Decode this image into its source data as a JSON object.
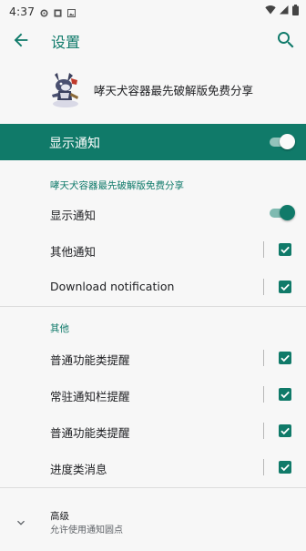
{
  "status_bar": {
    "time": "4:37"
  },
  "app_bar": {
    "title": "设置"
  },
  "app_header": {
    "app_name": "哮天犬容器最先破解版免费分享"
  },
  "master_toggle": {
    "label": "显示通知",
    "enabled": true
  },
  "section_app": {
    "header": "哮天犬容器最先破解版免费分享",
    "rows": [
      {
        "label": "显示通知",
        "control": "switch",
        "checked": true
      },
      {
        "label": "其他通知",
        "control": "checkbox",
        "checked": true
      },
      {
        "label": "Download notification",
        "control": "checkbox",
        "checked": true
      }
    ]
  },
  "section_other": {
    "header": "其他",
    "rows": [
      {
        "label": "普通功能类提醒",
        "control": "checkbox",
        "checked": true
      },
      {
        "label": "常驻通知栏提醒",
        "control": "checkbox",
        "checked": true
      },
      {
        "label": "普通功能类提醒",
        "control": "checkbox",
        "checked": true
      },
      {
        "label": "进度类消息",
        "control": "checkbox",
        "checked": true
      }
    ]
  },
  "advanced": {
    "title": "高级",
    "subtitle": "允许使用通知圆点"
  },
  "colors": {
    "accent": "#107a69",
    "title_teal": "#0f7a6a",
    "background": "#f7f7f7"
  },
  "icons": {
    "back": "arrow-left-icon",
    "search": "search-icon",
    "expand": "chevron-down-icon"
  }
}
